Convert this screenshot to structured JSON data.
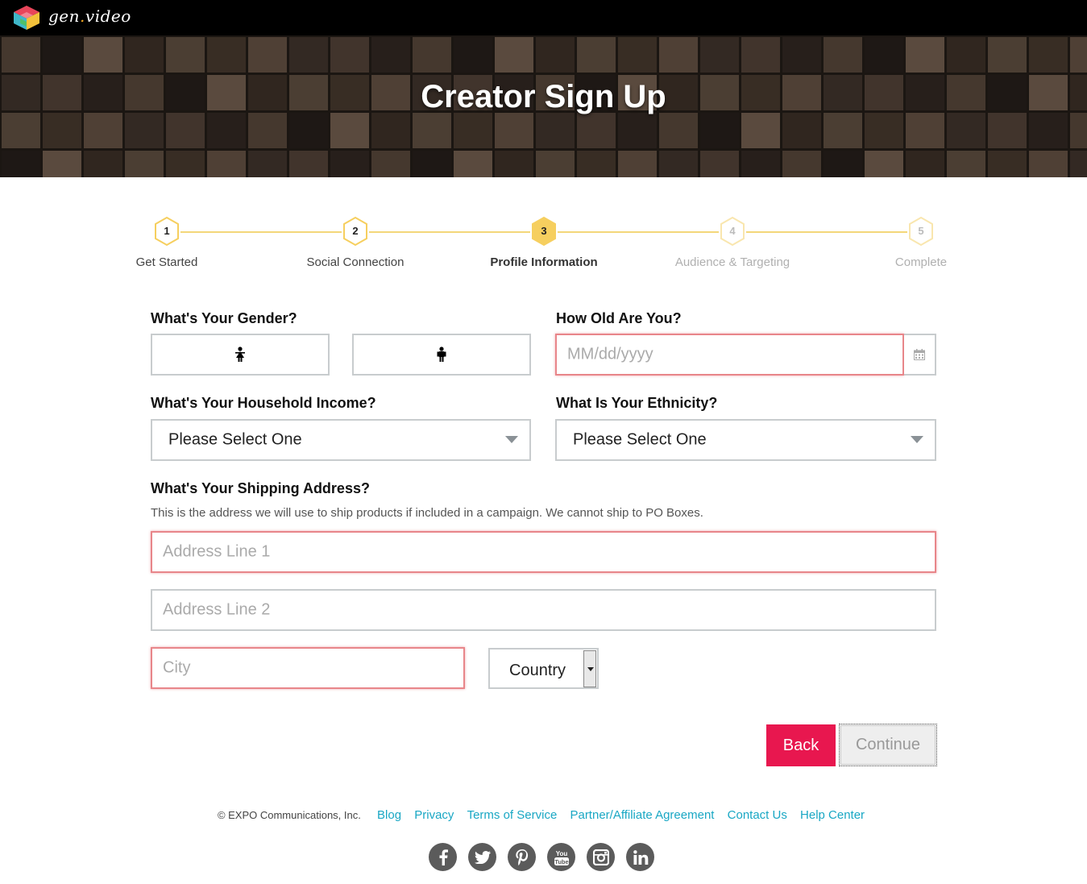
{
  "brand": {
    "name_part1": "gen",
    "name_dot": ".",
    "name_part2": "video"
  },
  "hero": {
    "title": "Creator Sign Up"
  },
  "steps": [
    {
      "num": "1",
      "label": "Get Started"
    },
    {
      "num": "2",
      "label": "Social Connection"
    },
    {
      "num": "3",
      "label": "Profile Information"
    },
    {
      "num": "4",
      "label": "Audience & Targeting"
    },
    {
      "num": "5",
      "label": "Complete"
    }
  ],
  "form": {
    "gender_label": "What's Your Gender?",
    "age_label": "How Old Are You?",
    "dob_placeholder": "MM/dd/yyyy",
    "income_label": "What's Your Household Income?",
    "income_value": "Please Select One",
    "ethnicity_label": "What Is Your Ethnicity?",
    "ethnicity_value": "Please Select One",
    "address_label": "What's Your Shipping Address?",
    "address_helper": "This is the address we will use to ship products if included in a campaign. We cannot ship to PO Boxes.",
    "address1_placeholder": "Address Line 1",
    "address2_placeholder": "Address Line 2",
    "city_placeholder": "City",
    "country_value": "Country"
  },
  "buttons": {
    "back": "Back",
    "continue": "Continue"
  },
  "footer": {
    "copyright": "© EXPO Communications, Inc.",
    "links": [
      "Blog",
      "Privacy",
      "Terms of Service",
      "Partner/Affiliate Agreement",
      "Contact Us",
      "Help Center"
    ]
  },
  "social": [
    "facebook-icon",
    "twitter-icon",
    "pinterest-icon",
    "youtube-icon",
    "instagram-icon",
    "linkedin-icon"
  ],
  "colors": {
    "accent": "#e8174f",
    "step_gold": "#f6cf5f",
    "link": "#19a7c4",
    "error_border": "#e8868a"
  }
}
